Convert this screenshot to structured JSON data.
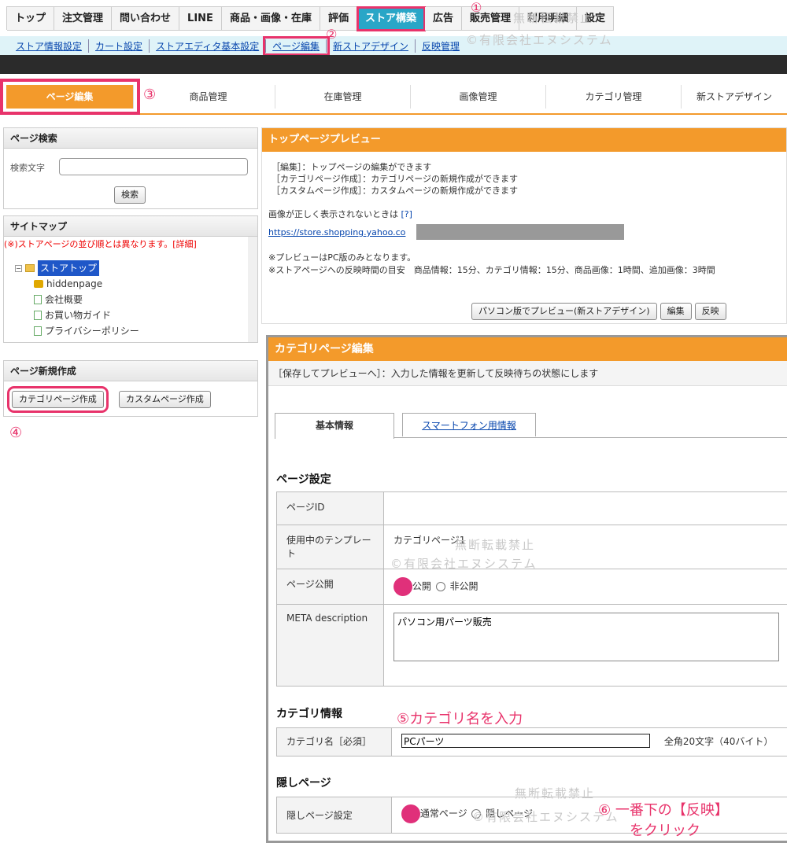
{
  "topnav": {
    "tabs": [
      "トップ",
      "注文管理",
      "問い合わせ",
      "LINE",
      "商品・画像・在庫",
      "評価",
      "ストア構築",
      "広告",
      "販売管理",
      "利用明細",
      "設定"
    ]
  },
  "subnav": {
    "items": [
      "ストア情報設定",
      "カート設定",
      "ストアエディタ基本設定",
      "ページ編集",
      "新ストアデザイン",
      "反映管理"
    ]
  },
  "tabs2": [
    "ページ編集",
    "商品管理",
    "在庫管理",
    "画像管理",
    "カテゴリ管理",
    "新ストアデザイン"
  ],
  "search": {
    "title": "ページ検索",
    "label": "検索文字",
    "value": "",
    "button": "検索"
  },
  "sitemap": {
    "title": "サイトマップ",
    "note": "(※)ストアページの並び順とは異なります。",
    "detail_link": "[詳細]",
    "root": "ストアトップ",
    "children": [
      "hiddenpage",
      "会社概要",
      "お買い物ガイド",
      "プライバシーポリシー"
    ]
  },
  "new_page": {
    "title": "ページ新規作成",
    "category_button": "カテゴリページ作成",
    "custom_button": "カスタムページ作成"
  },
  "preview": {
    "title": "トップページプレビュー",
    "lines": [
      "［編集］：トップページの編集ができます",
      "［カテゴリページ作成］：カテゴリページの新規作成ができます",
      "［カスタムページ作成］：カスタムページの新規作成ができます"
    ],
    "image_note": "画像が正しく表示されないときは",
    "image_note_link": "[?]",
    "url": "https://store.shopping.yahoo.co",
    "note1": "※プレビューはPC版のみとなります。",
    "note2": "※ストアページへの反映時間の目安　商品情報：15分、カテゴリ情報：15分、商品画像：1時間、追加画像：3時間",
    "btn_preview": "パソコン版でプレビュー(新ストアデザイン)",
    "btn_edit": "編集",
    "btn_reflect": "反映"
  },
  "category_edit": {
    "title": "カテゴリページ編集",
    "info": "［保存してプレビューへ］：入力した情報を更新して反映待ちの状態にします",
    "tab_basic": "基本情報",
    "tab_smartphone": "スマートフォン用情報",
    "section_page": "ページ設定",
    "page_id_label": "ページID",
    "page_id_value": "",
    "template_label": "使用中のテンプレート",
    "template_value": "カテゴリページ1",
    "publish_label": "ページ公開",
    "publish_on": "公開",
    "publish_off": "非公開",
    "meta_label": "META description",
    "meta_value": "パソコン用パーツ販売",
    "section_category": "カテゴリ情報",
    "cat_name_label": "カテゴリ名［必須］",
    "cat_name_value": "PCパーツ",
    "cat_name_hint": "全角20文字（40バイト）",
    "section_hidden": "隠しページ",
    "hidden_label": "隠しページ設定",
    "hidden_normal": "通常ページ",
    "hidden_hidden": "隠しページ"
  },
  "annotations": {
    "a1": "①",
    "a2": "②",
    "a3": "③",
    "a4": "④",
    "a5": "⑤カテゴリ名を入力",
    "a6_line1": "⑥ 一番下の【反映】",
    "a6_line2": "をクリック"
  },
  "watermarks": {
    "line1": "無断転載禁止",
    "line2": "©有限会社エヌシステム"
  },
  "colors": {
    "accent": "#f39a2b",
    "highlight": "#e8336b",
    "nav_active": "#29a6c7",
    "link": "#0645ad"
  }
}
